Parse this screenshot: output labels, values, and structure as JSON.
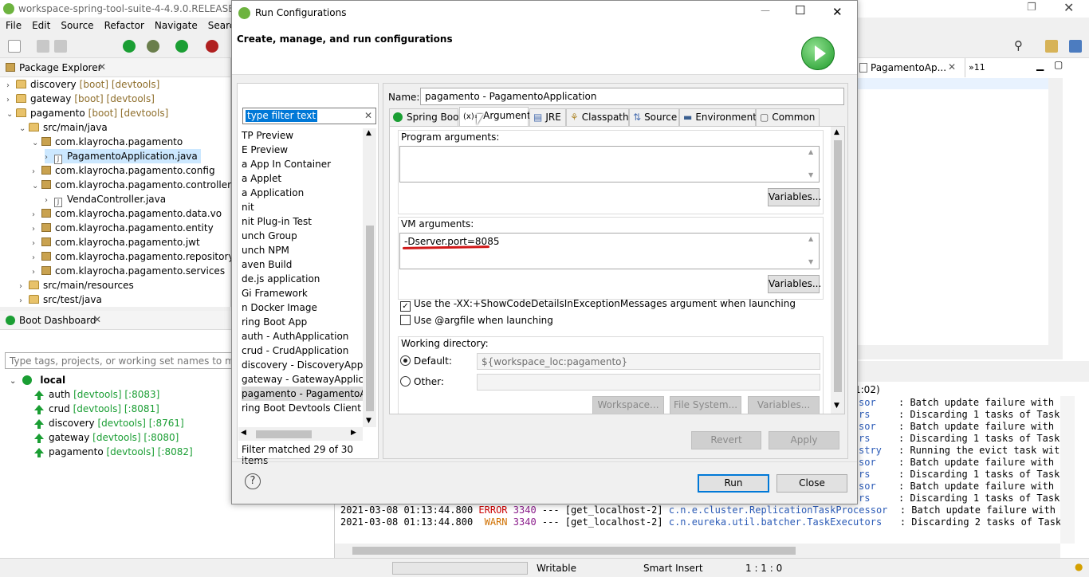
{
  "ide": {
    "title": "workspace-spring-tool-suite-4-4.9.0.RELEASE - pag",
    "menu": [
      "File",
      "Edit",
      "Source",
      "Refactor",
      "Navigate",
      "Search"
    ],
    "package_explorer": {
      "tab": "Package Explorer",
      "rows": [
        {
          "name": "discovery",
          "suffix": "[boot] [devtools]",
          "indent": 0,
          "twisty": "›"
        },
        {
          "name": "gateway",
          "suffix": "[boot] [devtools]",
          "indent": 0,
          "twisty": "›"
        },
        {
          "name": "pagamento",
          "suffix": "[boot] [devtools]",
          "indent": 0,
          "twisty": "⌄"
        },
        {
          "name": "src/main/java",
          "indent": 1,
          "twisty": "⌄"
        },
        {
          "name": "com.klayrocha.pagamento",
          "indent": 2,
          "twisty": "⌄"
        },
        {
          "name": "PagamentoApplication.java",
          "indent": 3,
          "twisty": "›"
        },
        {
          "name": "com.klayrocha.pagamento.config",
          "indent": 2,
          "twisty": "›"
        },
        {
          "name": "com.klayrocha.pagamento.controller",
          "indent": 2,
          "twisty": "⌄"
        },
        {
          "name": "VendaController.java",
          "indent": 3,
          "twisty": "›"
        },
        {
          "name": "com.klayrocha.pagamento.data.vo",
          "indent": 2,
          "twisty": "›"
        },
        {
          "name": "com.klayrocha.pagamento.entity",
          "indent": 2,
          "twisty": "›"
        },
        {
          "name": "com.klayrocha.pagamento.jwt",
          "indent": 2,
          "twisty": "›"
        },
        {
          "name": "com.klayrocha.pagamento.repository",
          "indent": 2,
          "twisty": "›"
        },
        {
          "name": "com.klayrocha.pagamento.services",
          "indent": 2,
          "twisty": "›"
        },
        {
          "name": "src/main/resources",
          "indent": 1,
          "twisty": "›"
        },
        {
          "name": "src/test/java",
          "indent": 1,
          "twisty": "›"
        }
      ]
    },
    "boot_dashboard": {
      "tab": "Boot Dashboard",
      "filter_placeholder": "Type tags, projects, or working set names to match (i",
      "root": "local",
      "apps": [
        {
          "name": "auth",
          "suffix": "[devtools] [:8083]"
        },
        {
          "name": "crud",
          "suffix": "[devtools] [:8081]"
        },
        {
          "name": "discovery",
          "suffix": "[devtools] [:8761]"
        },
        {
          "name": "gateway",
          "suffix": "[devtools] [:8080]"
        },
        {
          "name": "pagamento",
          "suffix": "[devtools] [:8082]"
        }
      ]
    },
    "editor_tab": "PagamentoAp...",
    "editor_more": "»11",
    "console": {
      "partial_header": "1:02)",
      "partial_rows": [
        {
          "left": "sor",
          "msg": ": Batch update failure with HT"
        },
        {
          "left": "rs",
          "msg": ": Discarding 1 tasks of TaskBa"
        },
        {
          "left": "sor",
          "msg": ": Batch update failure with HT"
        },
        {
          "left": "rs",
          "msg": ": Discarding 1 tasks of TaskBa"
        },
        {
          "left": "stry",
          "msg": ": Running the evict task with"
        },
        {
          "left": "sor",
          "msg": ": Batch update failure with HT"
        },
        {
          "left": "rs",
          "msg": ": Discarding 1 tasks of TaskBa"
        },
        {
          "left": "sor",
          "msg": ": Batch update failure with HT"
        },
        {
          "left": "rs",
          "msg": ": Discarding 1 tasks of TaskBa"
        }
      ],
      "full_rows": [
        {
          "ts": "2021-03-08 01:13:44.800",
          "level": "ERROR",
          "pid": "3340",
          "thread": "--- [get_localhost-2]",
          "logger": "c.n.e.cluster.ReplicationTaskProcessor",
          "msg": ": Batch update failure with HT"
        },
        {
          "ts": "2021-03-08 01:13:44.800",
          "level": " WARN",
          "pid": "3340",
          "thread": "--- [get_localhost-2]",
          "logger": "c.n.eureka.util.batcher.TaskExecutors",
          "msg": ": Discarding 2 tasks of TaskBa"
        }
      ]
    },
    "status": {
      "writable": "Writable",
      "insert": "Smart Insert",
      "position": "1 : 1 : 0"
    }
  },
  "dialog": {
    "title": "Run Configurations",
    "header": "Create, manage, and run configurations",
    "filter_value": "type filter text",
    "configs": [
      "TP Preview",
      "E Preview",
      "a App In Container",
      "a Applet",
      "a Application",
      "nit",
      "nit Plug-in Test",
      "unch Group",
      "unch NPM",
      "aven Build",
      "de.js application",
      "Gi Framework",
      "n Docker Image",
      "ring Boot App",
      "auth - AuthApplication",
      "crud - CrudApplication",
      "discovery - DiscoveryApplica",
      "gateway - GatewayApplicatio",
      "pagamento - PagamentoApp",
      "ring Boot Devtools Client"
    ],
    "selected_config": 18,
    "filter_status": "Filter matched 29 of 30 items",
    "name_label": "Name:",
    "name_value": "pagamento - PagamentoApplication",
    "tabs": [
      "Spring Boot",
      "Arguments",
      "JRE",
      "Classpath",
      "Source",
      "Environment",
      "Common"
    ],
    "tab_icons": [
      "●",
      "(x)=",
      "▤",
      "⚘",
      "⇅",
      "▬",
      "▢"
    ],
    "program_args_label": "Program arguments:",
    "vm_args_label": "VM arguments:",
    "vm_args_value": "-Dserver.port=8085",
    "variables_btn": "Variables...",
    "chk1": "Use the -XX:+ShowCodeDetailsInExceptionMessages argument when launching",
    "chk2": "Use @argfile when launching",
    "working_dir_label": "Working directory:",
    "default_label": "Default:",
    "default_value": "${workspace_loc:pagamento}",
    "other_label": "Other:",
    "workspace_btn": "Workspace...",
    "filesystem_btn": "File System...",
    "revert_btn": "Revert",
    "apply_btn": "Apply",
    "run_btn": "Run",
    "close_btn": "Close",
    "help": "?"
  }
}
